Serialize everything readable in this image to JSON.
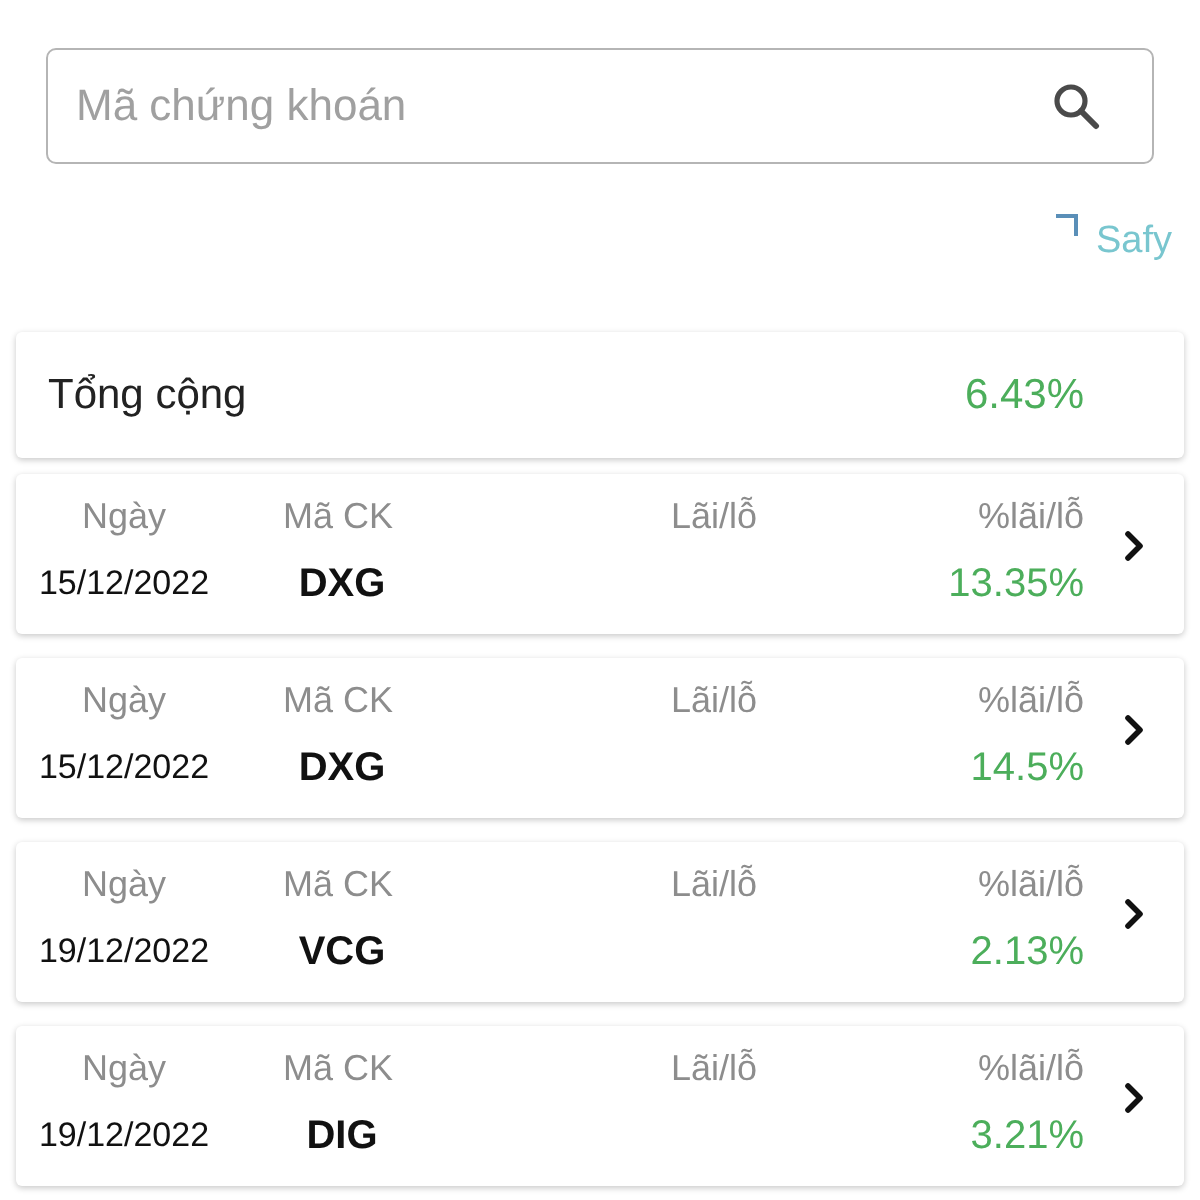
{
  "search": {
    "placeholder": "Mã chứng khoán"
  },
  "brand": {
    "name": "Safy"
  },
  "total": {
    "label": "Tổng cộng",
    "percent": "6.43%"
  },
  "trades": [
    {
      "labels": [
        "Ngày",
        "Mã CK",
        "Lãi/lỗ",
        "%lãi/lỗ"
      ],
      "date": "15/12/2022",
      "code": "DXG",
      "percent": "13.35%"
    },
    {
      "labels": [
        "Ngày",
        "Mã CK",
        "Lãi/lỗ",
        "%lãi/lỗ"
      ],
      "date": "15/12/2022",
      "code": "DXG",
      "percent": "14.5%"
    },
    {
      "labels": [
        "Ngày",
        "Mã CK",
        "Lãi/lỗ",
        "%lãi/lỗ"
      ],
      "date": "19/12/2022",
      "code": "VCG",
      "percent": "2.13%"
    },
    {
      "labels": [
        "Ngày",
        "Mã CK",
        "Lãi/lỗ",
        "%lãi/lỗ"
      ],
      "date": "19/12/2022",
      "code": "DIG",
      "percent": "3.21%"
    }
  ]
}
